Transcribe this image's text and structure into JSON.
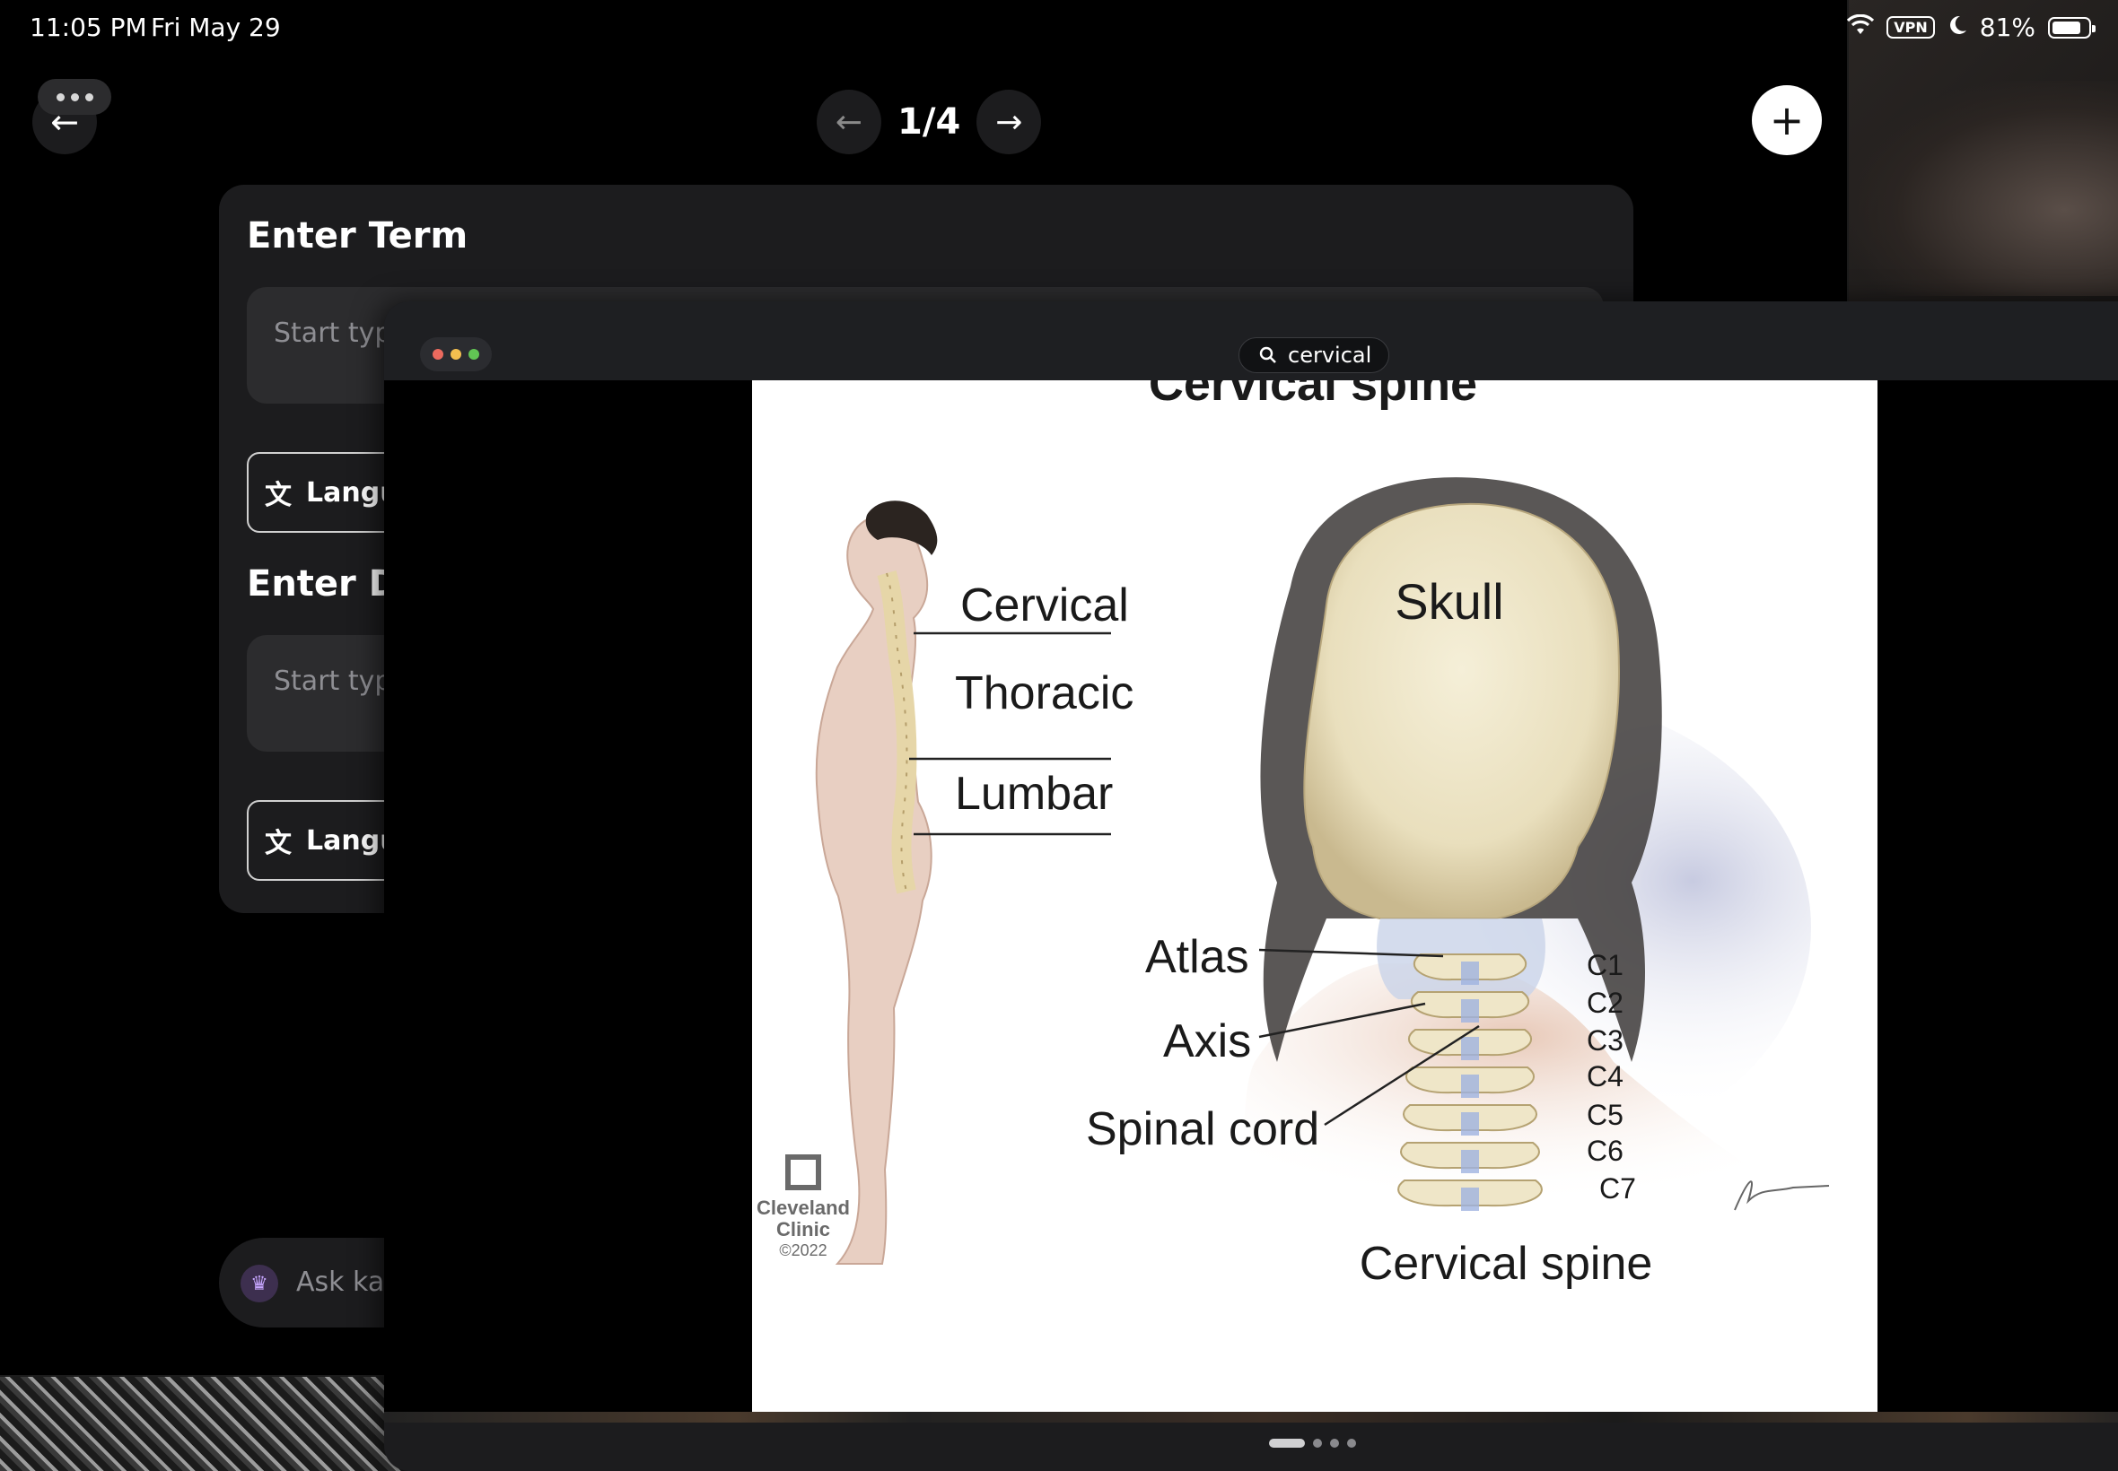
{
  "status_bar": {
    "time": "11:05 PM",
    "date": "Fri May 29",
    "vpn": "VPN",
    "battery": "81%",
    "battery_level": 0.81
  },
  "editor": {
    "pager_text": "1/4",
    "term_label": "Enter Term",
    "term_placeholder": "Start typi",
    "language_label": "Langu",
    "definition_label": "Enter De",
    "definition_placeholder": "Start typ",
    "language_label_2": "Langu",
    "ask_placeholder": "Ask ka"
  },
  "browser": {
    "search_query": "cervical",
    "pages_total": 4,
    "page_active": 1
  },
  "illustration": {
    "title_cut": "Cervical spine",
    "labels": {
      "cervical": "Cervical",
      "thoracic": "Thoracic",
      "lumbar": "Lumbar",
      "skull": "Skull",
      "atlas": "Atlas",
      "axis": "Axis",
      "spinal_cord": "Spinal cord",
      "caption": "Cervical spine",
      "c1": "C1",
      "c2": "C2",
      "c3": "C3",
      "c4": "C4",
      "c5": "C5",
      "c6": "C6",
      "c7": "C7"
    },
    "logo_line1": "Cleveland",
    "logo_line2": "Clinic",
    "logo_year": "©2022",
    "signature": "Jkamasz"
  },
  "colors": {
    "card_bg": "#1c1c1e",
    "input_bg": "#2c2c2e",
    "traffic_red": "#ec6a5e",
    "traffic_yellow": "#f4bf4f",
    "traffic_green": "#61c554"
  }
}
